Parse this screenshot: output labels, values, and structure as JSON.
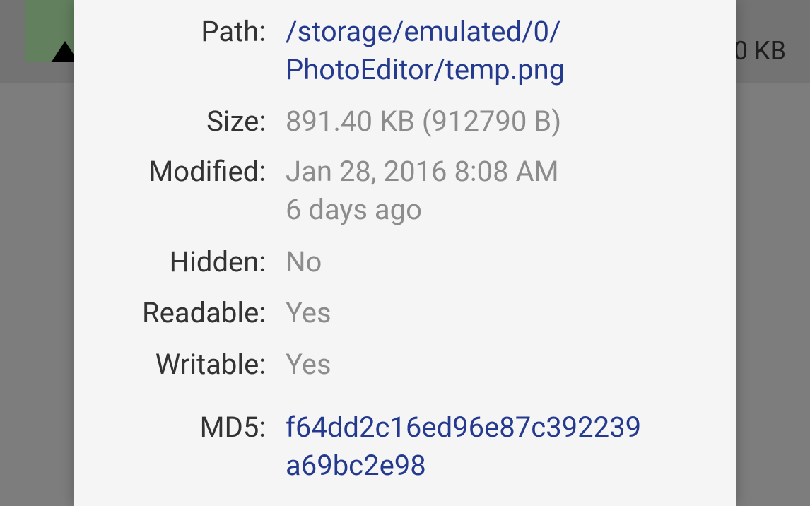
{
  "background": {
    "size_text": "0 KB"
  },
  "dialog": {
    "path": {
      "label": "Path:",
      "line1": "/storage/emulated/0/",
      "line2": "PhotoEditor/temp.png"
    },
    "size": {
      "label": "Size:",
      "value": "891.40 KB (912790 B)"
    },
    "modified": {
      "label": "Modified:",
      "line1": "Jan 28, 2016 8:08 AM",
      "line2": "6 days ago"
    },
    "hidden": {
      "label": "Hidden:",
      "value": "No"
    },
    "readable": {
      "label": "Readable:",
      "value": "Yes"
    },
    "writable": {
      "label": "Writable:",
      "value": "Yes"
    },
    "md5": {
      "label": "MD5:",
      "line1": "f64dd2c16ed96e87c392239",
      "line2": "a69bc2e98"
    }
  },
  "colors": {
    "link_value": "#243a8f",
    "plain_value": "#8c8c8c",
    "label": "#333333",
    "dialog_bg": "#f5f5f5",
    "scrim": "#7d7d7d"
  }
}
